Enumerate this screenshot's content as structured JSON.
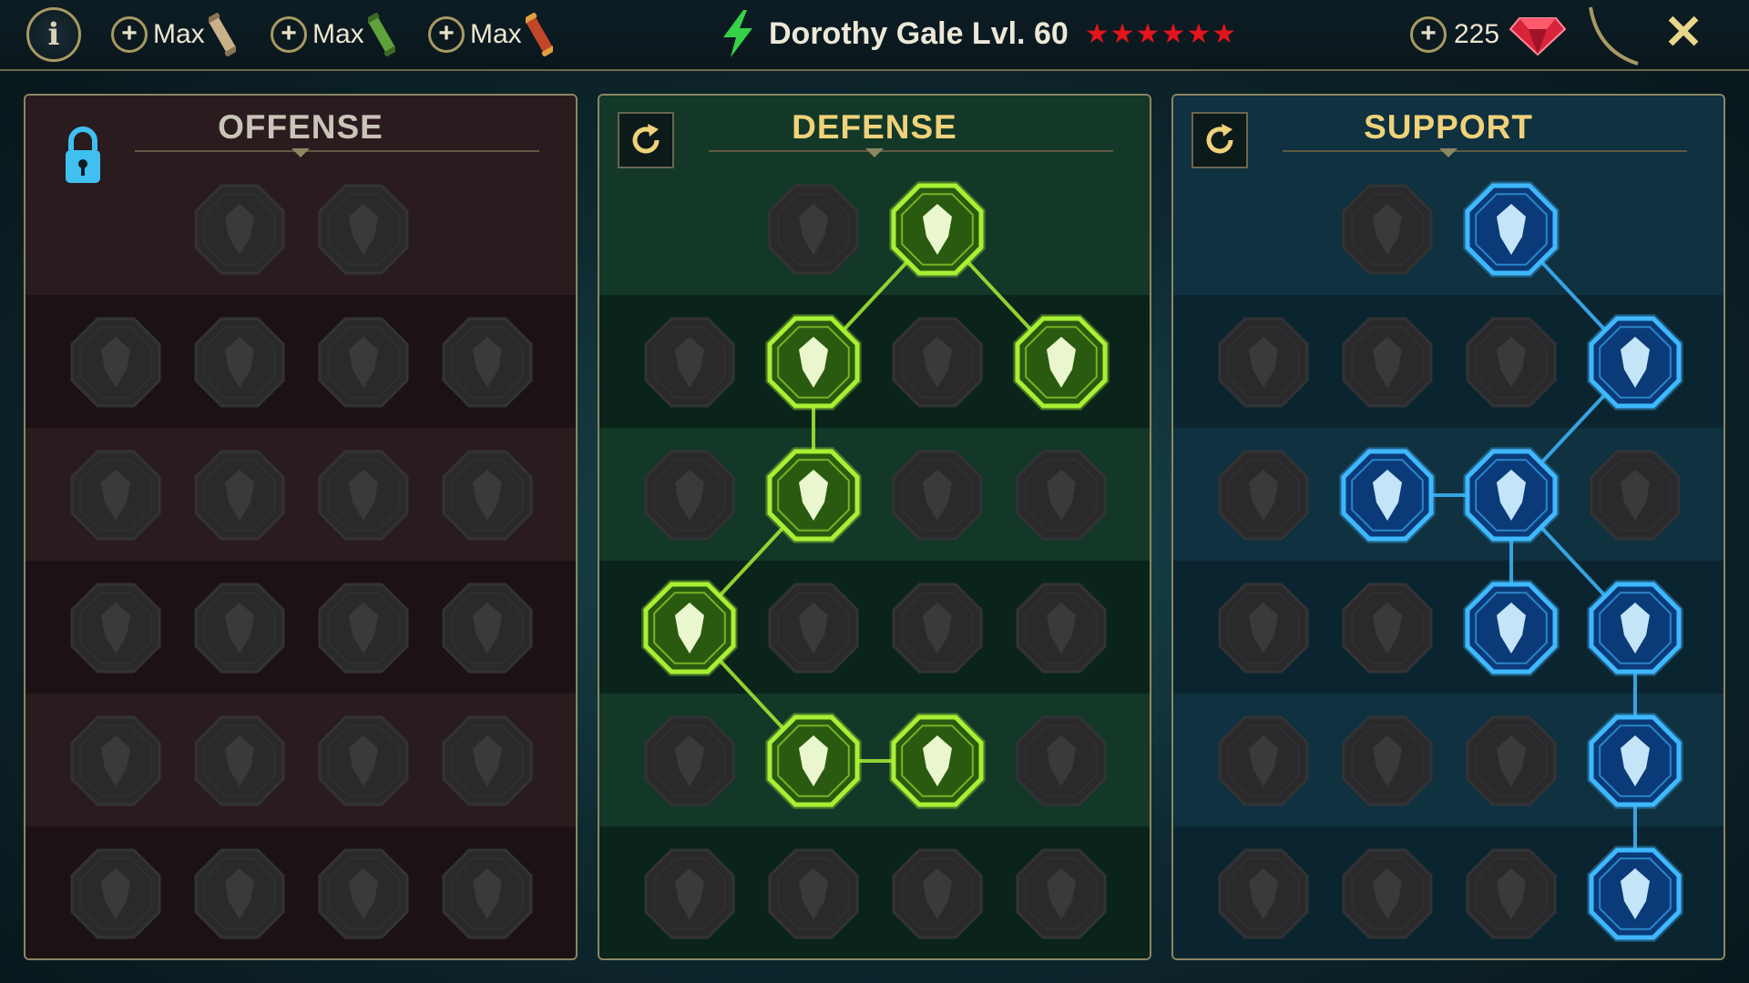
{
  "topbar": {
    "info_label": "i",
    "max_buttons": [
      {
        "label": "Max",
        "scroll": "tan-scroll-icon",
        "color": "#c9b28a"
      },
      {
        "label": "Max",
        "scroll": "green-scroll-icon",
        "color": "#5fa13a"
      },
      {
        "label": "Max",
        "scroll": "red-scroll-icon",
        "color": "#c2462a"
      }
    ],
    "hero_name": "Dorothy Gale Lvl. 60",
    "stars": "★★★★★★",
    "gem_count": "225",
    "close_label": "✕"
  },
  "colors": {
    "offense_active": "#7a7275",
    "defense_active": "#a8f034",
    "support_active": "#3fb8ff",
    "inactive": "#3a3a3a"
  },
  "panels": [
    {
      "key": "offense",
      "title": "OFFENSE",
      "header_icon": "lock-icon",
      "rows": [
        [
          null,
          "crossed-swords-icon",
          "daggers-icon",
          null
        ],
        [
          "horned-warrior-icon",
          "slashing-blade-icon",
          "shield-break-icon",
          "spiked-heart-icon"
        ],
        [
          "arrows-figure-icon",
          "fanged-maw-icon",
          "skull-scythe-icon",
          "knife-hand-icon"
        ],
        [
          "blood-dagger-icon",
          "fist-blade-icon",
          "axe-icon",
          "lightning-chain-icon"
        ],
        [
          "trident-burst-icon",
          "twin-skulls-icon",
          "sword-circle-icon",
          "berserker-icon"
        ],
        [
          "sparkle-sword-icon",
          "knight-helm-icon",
          "horned-demon-icon",
          "skull-spike-icon"
        ]
      ],
      "active": [],
      "links": []
    },
    {
      "key": "defense",
      "title": "DEFENSE",
      "header_icon": "reset-icon",
      "rows": [
        [
          null,
          "armor-plates-icon",
          "raised-fist-icon",
          null
        ],
        [
          "shield-crest-icon",
          "stone-heart-icon",
          "armored-fighter-icon",
          "crossed-knives-icon"
        ],
        [
          "cracked-figure-icon",
          "knight-shield-icon",
          "skull-heart-icon",
          "veiled-head-icon"
        ],
        [
          "crowd-cheer-icon",
          "hourglass-skull-icon",
          "open-hand-icon",
          "bull-head-icon"
        ],
        [
          "speed-runner-icon",
          "triple-drops-icon",
          "radiant-skull-icon",
          "grasping-hand-icon"
        ],
        [
          "spiked-warrior-icon",
          "winged-shield-icon",
          "bearded-face-icon",
          "muscle-figure-icon"
        ]
      ],
      "active": [
        [
          0,
          2
        ],
        [
          1,
          1
        ],
        [
          1,
          3
        ],
        [
          2,
          1
        ],
        [
          3,
          0
        ],
        [
          4,
          1
        ],
        [
          4,
          2
        ]
      ],
      "links": [
        [
          [
            0,
            2
          ],
          [
            1,
            1
          ]
        ],
        [
          [
            0,
            2
          ],
          [
            1,
            3
          ]
        ],
        [
          [
            1,
            1
          ],
          [
            2,
            1
          ]
        ],
        [
          [
            2,
            1
          ],
          [
            3,
            0
          ]
        ],
        [
          [
            3,
            0
          ],
          [
            4,
            1
          ]
        ],
        [
          [
            4,
            1
          ],
          [
            4,
            2
          ]
        ]
      ]
    },
    {
      "key": "support",
      "title": "SUPPORT",
      "header_icon": "reset-icon",
      "rows": [
        [
          null,
          "heart-plus-icon",
          "swirl-hand-icon",
          null
        ],
        [
          "praying-hands-icon",
          "guard-shield-icon",
          "smoking-skull-icon",
          "sweeping-kick-icon"
        ],
        [
          "healer-figure-icon",
          "lightning-bolt-icon",
          "shattered-ground-icon",
          "silhouette-icon"
        ],
        [
          "chained-heart-icon",
          "comet-icon",
          "open-book-icon",
          "fury-eyes-icon"
        ],
        [
          "compass-star-icon",
          "fast-boot-icon",
          "all-seeing-eye-icon",
          "voodoo-doll-icon"
        ],
        [
          "potion-icon",
          "skull-crown-icon",
          "iron-fist-icon",
          "eagle-head-icon"
        ]
      ],
      "active": [
        [
          0,
          2
        ],
        [
          1,
          3
        ],
        [
          2,
          1
        ],
        [
          2,
          2
        ],
        [
          3,
          2
        ],
        [
          3,
          3
        ],
        [
          4,
          3
        ],
        [
          5,
          3
        ]
      ],
      "links": [
        [
          [
            0,
            2
          ],
          [
            1,
            3
          ]
        ],
        [
          [
            1,
            3
          ],
          [
            2,
            2
          ]
        ],
        [
          [
            2,
            1
          ],
          [
            2,
            2
          ]
        ],
        [
          [
            2,
            2
          ],
          [
            3,
            2
          ]
        ],
        [
          [
            2,
            2
          ],
          [
            3,
            3
          ]
        ],
        [
          [
            3,
            3
          ],
          [
            4,
            3
          ]
        ],
        [
          [
            4,
            3
          ],
          [
            5,
            3
          ]
        ]
      ]
    }
  ]
}
